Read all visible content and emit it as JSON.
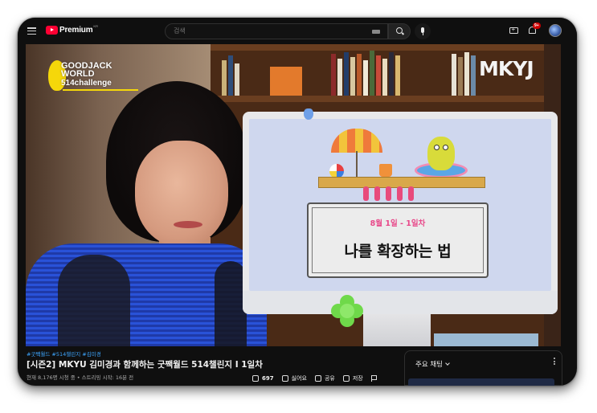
{
  "header": {
    "logo_text": "Premium",
    "logo_sup": "KR",
    "search_placeholder": "검색",
    "notification_count": "9+"
  },
  "video": {
    "watermark_left": [
      "GOODJACK",
      "WORLD",
      "514challenge"
    ],
    "watermark_right": "MKYJ",
    "screen_card_date": "8월 1일 - 1일차",
    "screen_card_title": "나를 확장하는 법"
  },
  "info": {
    "tags": "#굿짹월드 #514챌린지 #김미경",
    "title": "[시즌2] MKYU 김미경과 함께하는 굿짹월드 514챌린지 I 1일차",
    "meta": "현재 8,176명 시청 중 • 스트리밍 시작: 16분 전"
  },
  "actions": {
    "like_count": "697",
    "dislike_label": "싫어요",
    "share_label": "공유",
    "save_label": "저장"
  },
  "chat": {
    "header": "주요 채팅"
  },
  "colors": {
    "brand_red": "#ff0033",
    "link_blue": "#3ea6ff",
    "card_pink": "#e8498a"
  }
}
